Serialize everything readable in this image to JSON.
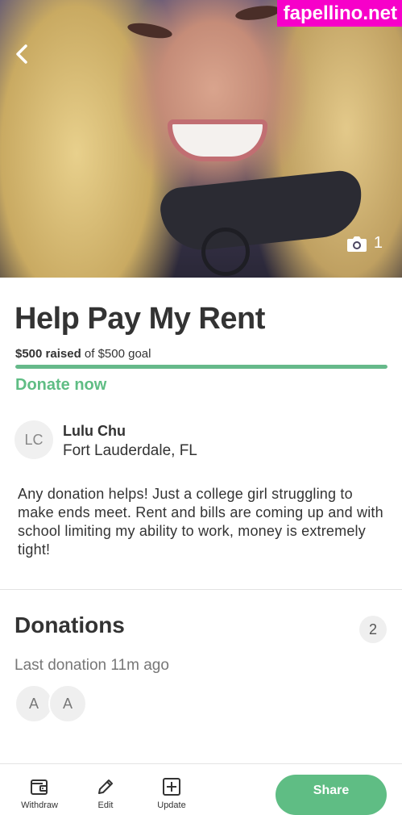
{
  "watermark": "fapellino.net",
  "hero": {
    "photo_count": "1"
  },
  "campaign": {
    "title": "Help Pay My Rent",
    "raised_amount": "$500 raised",
    "goal_text": "of $500 goal",
    "progress_fraction": 1.0,
    "donate_label": "Donate now"
  },
  "organizer": {
    "initials": "LC",
    "name": "Lulu Chu",
    "location": "Fort Lauderdale, FL"
  },
  "story": "Any donation helps! Just a college girl struggling to make ends meet. Rent and bills are coming up and with school limiting my ability to work, money is extremely tight!",
  "donations": {
    "heading": "Donations",
    "count": "2",
    "last_donation": "Last donation 11m ago",
    "donors": [
      "A",
      "A"
    ]
  },
  "toolbar": {
    "withdraw_label": "Withdraw",
    "edit_label": "Edit",
    "update_label": "Update",
    "share_label": "Share"
  },
  "colors": {
    "accent": "#5fbd84",
    "progress": "#66b98a",
    "watermark_bg": "#f700c9"
  }
}
